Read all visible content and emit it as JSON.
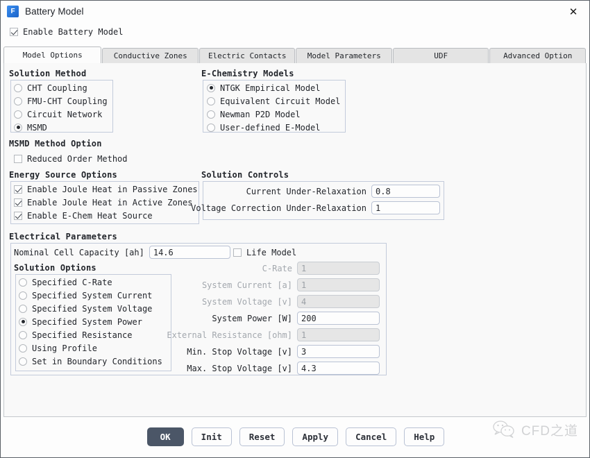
{
  "window": {
    "title": "Battery Model",
    "app_icon": "fluent-f-icon",
    "close_icon": "close-icon"
  },
  "enable_model": {
    "label": "Enable Battery Model",
    "checked": true
  },
  "tabs": [
    {
      "label": "Model Options",
      "active": true
    },
    {
      "label": "Conductive Zones",
      "active": false
    },
    {
      "label": "Electric Contacts",
      "active": false
    },
    {
      "label": "Model Parameters",
      "active": false
    },
    {
      "label": "UDF",
      "active": false
    },
    {
      "label": "Advanced Option",
      "active": false
    }
  ],
  "solution_method": {
    "title": "Solution Method",
    "options": [
      {
        "label": "CHT Coupling",
        "selected": false
      },
      {
        "label": "FMU-CHT Coupling",
        "selected": false
      },
      {
        "label": "Circuit Network",
        "selected": false
      },
      {
        "label": "MSMD",
        "selected": true
      }
    ]
  },
  "msmd_method_option": {
    "title": "MSMD Method Option",
    "reduced_order": {
      "label": "Reduced Order Method",
      "checked": false
    }
  },
  "echemistry_models": {
    "title": "E-Chemistry Models",
    "options": [
      {
        "label": "NTGK Empirical Model",
        "selected": true
      },
      {
        "label": "Equivalent Circuit Model",
        "selected": false
      },
      {
        "label": "Newman P2D Model",
        "selected": false
      },
      {
        "label": "User-defined E-Model",
        "selected": false
      }
    ]
  },
  "energy_source_options": {
    "title": "Energy Source Options",
    "options": [
      {
        "label": "Enable Joule Heat in Passive Zones",
        "checked": true
      },
      {
        "label": "Enable Joule Heat in Active Zones",
        "checked": true
      },
      {
        "label": "Enable E-Chem Heat Source",
        "checked": true
      }
    ]
  },
  "solution_controls": {
    "title": "Solution Controls",
    "fields": [
      {
        "label": "Current Under-Relaxation",
        "value": "0.8",
        "disabled": false
      },
      {
        "label": "Voltage Correction Under-Relaxation",
        "value": "1",
        "disabled": false
      }
    ]
  },
  "electrical_parameters": {
    "title": "Electrical Parameters",
    "nominal_cell_capacity": {
      "label": "Nominal Cell Capacity [ah]",
      "value": "14.6"
    },
    "life_model": {
      "label": "Life Model",
      "checked": false
    },
    "solution_options": {
      "title": "Solution Options",
      "options": [
        {
          "label": "Specified C-Rate",
          "selected": false
        },
        {
          "label": "Specified System Current",
          "selected": false
        },
        {
          "label": "Specified System Voltage",
          "selected": false
        },
        {
          "label": "Specified System Power",
          "selected": true
        },
        {
          "label": "Specified Resistance",
          "selected": false
        },
        {
          "label": "Using Profile",
          "selected": false
        },
        {
          "label": "Set in Boundary Conditions",
          "selected": false
        }
      ]
    },
    "value_fields": [
      {
        "label": "C-Rate",
        "value": "1",
        "disabled": true
      },
      {
        "label": "System Current [a]",
        "value": "1",
        "disabled": true
      },
      {
        "label": "System Voltage [v]",
        "value": "4",
        "disabled": true
      },
      {
        "label": "System Power [W]",
        "value": "200",
        "disabled": false
      },
      {
        "label": "External Resistance [ohm]",
        "value": "1",
        "disabled": true
      },
      {
        "label": "Min. Stop Voltage [v]",
        "value": "3",
        "disabled": false
      },
      {
        "label": "Max. Stop Voltage [v]",
        "value": "4.3",
        "disabled": false
      }
    ]
  },
  "buttons": [
    {
      "label": "OK",
      "primary": true
    },
    {
      "label": "Init",
      "primary": false
    },
    {
      "label": "Reset",
      "primary": false
    },
    {
      "label": "Apply",
      "primary": false
    },
    {
      "label": "Cancel",
      "primary": false
    },
    {
      "label": "Help",
      "primary": false
    }
  ],
  "watermark": {
    "text": "CFD之道",
    "icon": "wechat-icon"
  },
  "colors": {
    "accent": "#4b5667",
    "icon_blue": "#1b63c8",
    "group_border": "#c3cbdb",
    "disabled_text": "#a3a8ae"
  }
}
